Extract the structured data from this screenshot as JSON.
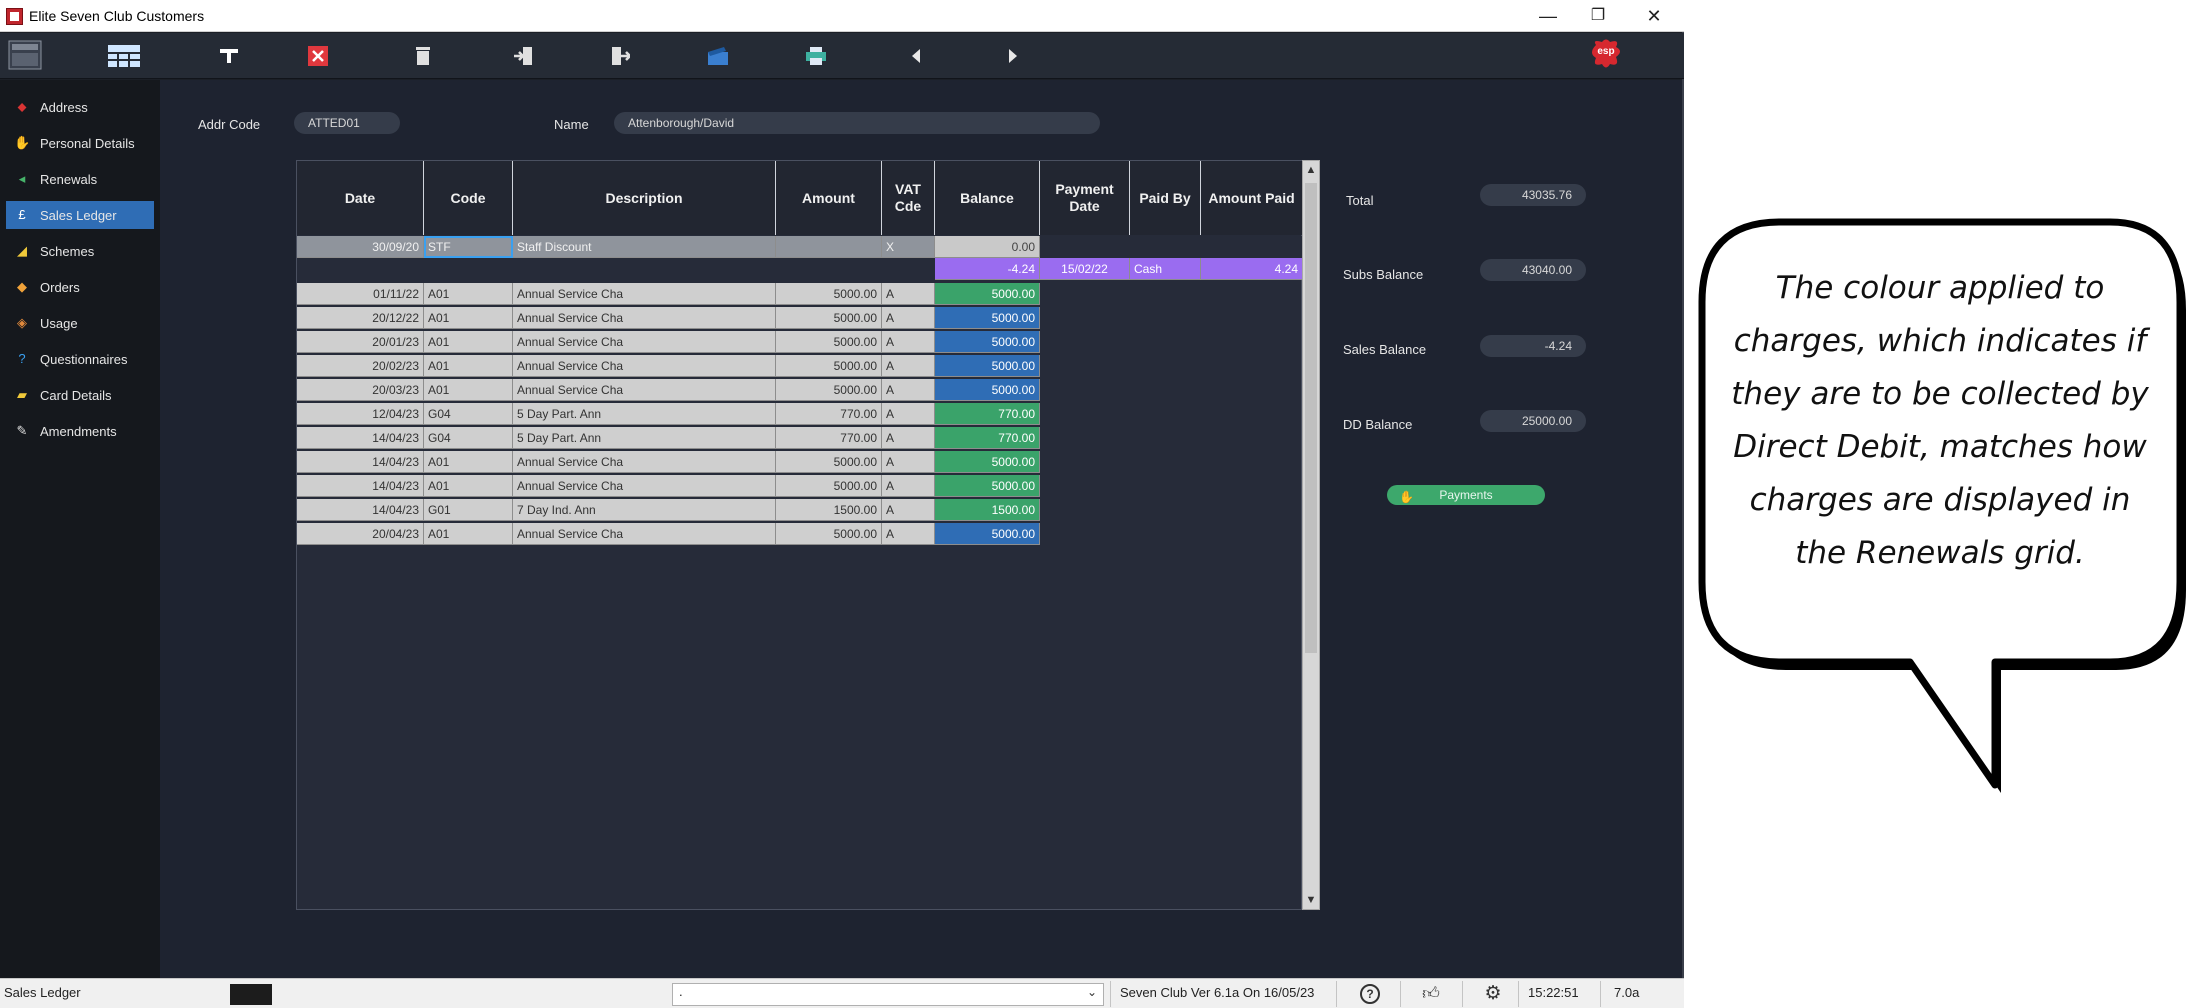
{
  "window": {
    "title": "Elite Seven Club Customers",
    "minimize": "—",
    "restore": "❐",
    "close": "✕"
  },
  "brand": {
    "logo_text": "esp",
    "color": "#c0262d"
  },
  "sidebar": {
    "items": [
      {
        "label": "Address",
        "icon": "map-pin-icon",
        "glyph": "⬥",
        "color": "#d93434"
      },
      {
        "label": "Personal Details",
        "icon": "hand-icon",
        "glyph": "✋",
        "color": "#e7e2d6"
      },
      {
        "label": "Renewals",
        "icon": "renew-icon",
        "glyph": "◂",
        "color": "#46b36a"
      },
      {
        "label": "Sales Ledger",
        "icon": "pound-icon",
        "glyph": "£",
        "color": "#ffffff"
      },
      {
        "label": "Schemes",
        "icon": "schemes-icon",
        "glyph": "◢",
        "color": "#f0c93a"
      },
      {
        "label": "Orders",
        "icon": "orders-icon",
        "glyph": "◆",
        "color": "#f0a23a"
      },
      {
        "label": "Usage",
        "icon": "usage-icon",
        "glyph": "◈",
        "color": "#e28a3c"
      },
      {
        "label": "Questionnaires",
        "icon": "question-icon",
        "glyph": "?",
        "color": "#3aa0f0"
      },
      {
        "label": "Card Details",
        "icon": "card-icon",
        "glyph": "▰",
        "color": "#f0c93a"
      },
      {
        "label": "Amendments",
        "icon": "pencil-icon",
        "glyph": "✎",
        "color": "#e0e0e0"
      }
    ],
    "active": "Sales Ledger"
  },
  "form": {
    "addr_code_label": "Addr Code",
    "addr_code": "ATTED01",
    "name_label": "Name",
    "name": "Attenborough/David"
  },
  "ledger": {
    "columns": [
      "Date",
      "Code",
      "Description",
      "Amount",
      "VAT Cde",
      "Balance",
      "Payment Date",
      "Paid By",
      "Amount Paid"
    ],
    "rows": [
      {
        "date": "30/09/20",
        "code": "STF",
        "description": "Staff Discount",
        "amount": "",
        "vat": "X",
        "balance": "0.00",
        "balance_color": "#c9c9c9",
        "pay_date": "",
        "paid_by": "",
        "amount_paid": "",
        "row_color": "#8f949c"
      },
      {
        "date": "",
        "code": "",
        "description": "",
        "amount": "",
        "vat": "",
        "balance": "-4.24",
        "balance_color": "#9a6cf0",
        "pay_date": "15/02/22",
        "paid_by": "Cash",
        "amount_paid": "4.24",
        "row_color": ""
      },
      {
        "date": "01/11/22",
        "code": "A01",
        "description": "Annual Service Cha",
        "amount": "5000.00",
        "vat": "A",
        "balance": "5000.00",
        "balance_color": "#3aa36a"
      },
      {
        "date": "20/12/22",
        "code": "A01",
        "description": "Annual Service Cha",
        "amount": "5000.00",
        "vat": "A",
        "balance": "5000.00",
        "balance_color": "#2f6db5"
      },
      {
        "date": "20/01/23",
        "code": "A01",
        "description": "Annual Service Cha",
        "amount": "5000.00",
        "vat": "A",
        "balance": "5000.00",
        "balance_color": "#2f6db5"
      },
      {
        "date": "20/02/23",
        "code": "A01",
        "description": "Annual Service Cha",
        "amount": "5000.00",
        "vat": "A",
        "balance": "5000.00",
        "balance_color": "#2f6db5"
      },
      {
        "date": "20/03/23",
        "code": "A01",
        "description": "Annual Service Cha",
        "amount": "5000.00",
        "vat": "A",
        "balance": "5000.00",
        "balance_color": "#2f6db5"
      },
      {
        "date": "12/04/23",
        "code": "G04",
        "description": "5 Day Part. Ann",
        "amount": "770.00",
        "vat": "A",
        "balance": "770.00",
        "balance_color": "#3aa36a"
      },
      {
        "date": "14/04/23",
        "code": "G04",
        "description": "5 Day Part. Ann",
        "amount": "770.00",
        "vat": "A",
        "balance": "770.00",
        "balance_color": "#3aa36a"
      },
      {
        "date": "14/04/23",
        "code": "A01",
        "description": "Annual Service Cha",
        "amount": "5000.00",
        "vat": "A",
        "balance": "5000.00",
        "balance_color": "#3aa36a"
      },
      {
        "date": "14/04/23",
        "code": "A01",
        "description": "Annual Service Cha",
        "amount": "5000.00",
        "vat": "A",
        "balance": "5000.00",
        "balance_color": "#3aa36a"
      },
      {
        "date": "14/04/23",
        "code": "G01",
        "description": "7 Day Ind. Ann",
        "amount": "1500.00",
        "vat": "A",
        "balance": "1500.00",
        "balance_color": "#3aa36a"
      },
      {
        "date": "20/04/23",
        "code": "A01",
        "description": "Annual Service Cha",
        "amount": "5000.00",
        "vat": "A",
        "balance": "5000.00",
        "balance_color": "#2f6db5"
      }
    ]
  },
  "totals": {
    "total_label": "Total",
    "total": "43035.76",
    "subs_label": "Subs Balance",
    "subs": "43040.00",
    "sales_label": "Sales Balance",
    "sales": "-4.24",
    "dd_label": "DD Balance",
    "dd": "25000.00"
  },
  "payments_button": "Payments",
  "statusbar": {
    "left": "Sales Ledger",
    "dropdown_value": ".",
    "version": "Seven Club Ver 6.1a On 16/05/23",
    "time": "15:22:51",
    "build": "7.0a"
  },
  "callout": {
    "text": "The colour applied to charges, which indicates if they are to be collected by Direct Debit, matches how charges are displayed in the Renewals grid."
  }
}
